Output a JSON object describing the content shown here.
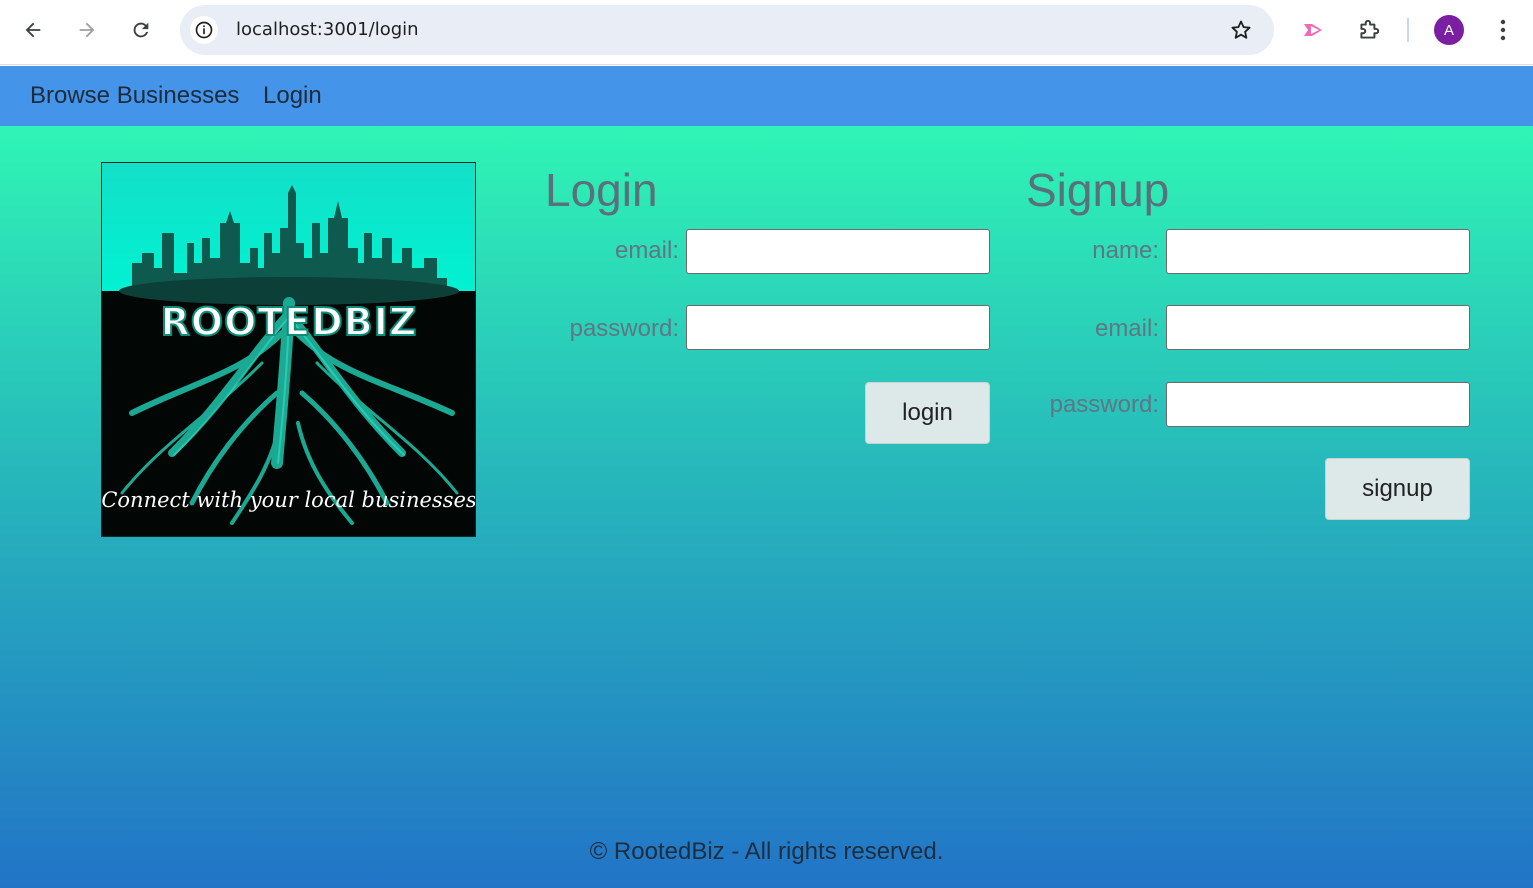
{
  "browser": {
    "url": "localhost:3001/login",
    "avatar_letter": "A",
    "icons": [
      "back-arrow-icon",
      "forward-arrow-icon",
      "reload-icon",
      "site-info-icon",
      "bookmark-star-icon",
      "extension-cast-icon",
      "extensions-puzzle-icon",
      "more-vert-icon"
    ]
  },
  "navbar": {
    "links": [
      {
        "label": "Browse Businesses"
      },
      {
        "label": "Login"
      }
    ],
    "color": "#4494ea"
  },
  "logo": {
    "brand": "ROOTEDBIZ",
    "tagline": "Connect with your local businesses"
  },
  "login": {
    "heading": "Login",
    "email_label": "email:",
    "email_value": "",
    "password_label": "password:",
    "password_value": "",
    "button_label": "login"
  },
  "signup": {
    "heading": "Signup",
    "name_label": "name:",
    "name_value": "",
    "email_label": "email:",
    "email_value": "",
    "password_label": "password:",
    "password_value": "",
    "button_label": "signup"
  },
  "footer": {
    "text": "© RootedBiz - All rights reserved."
  },
  "colors": {
    "gradient_top": "#2ff5b5",
    "gradient_bottom": "#2274c7",
    "heading_text": "#5a707a",
    "button_bg": "#dde8e8"
  }
}
